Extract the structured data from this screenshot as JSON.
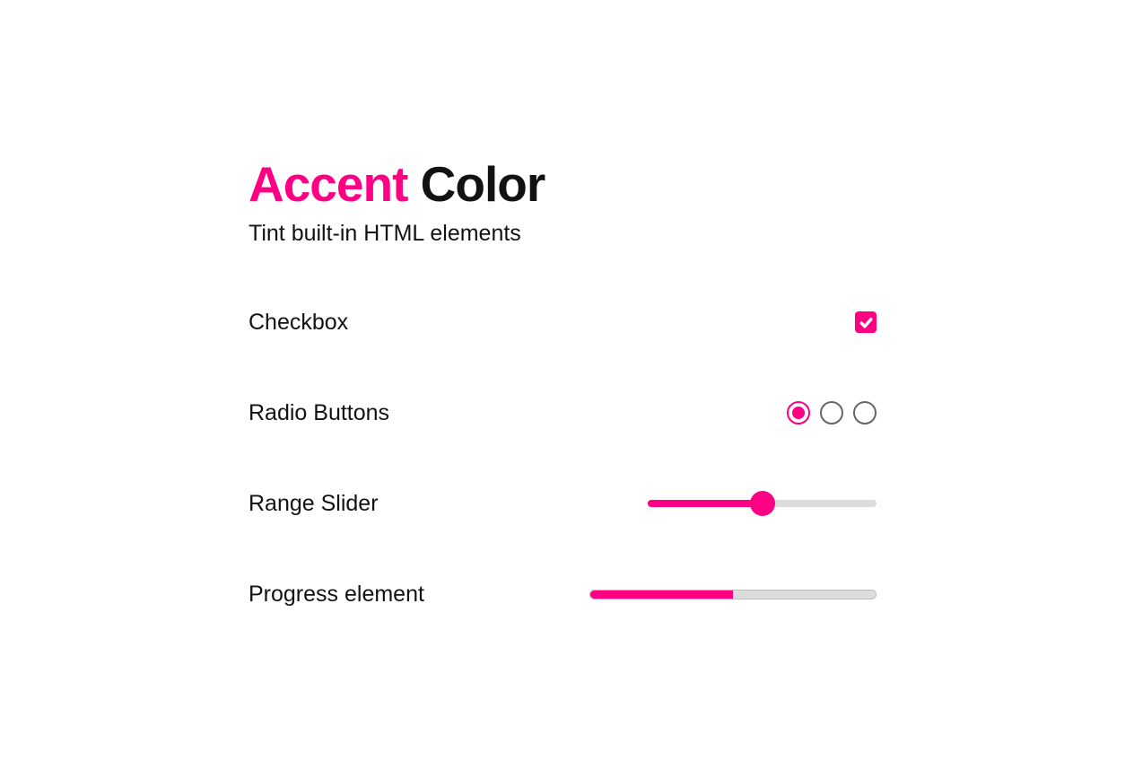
{
  "accent_color": "#ff0084",
  "title": {
    "accent_word": "Accent",
    "rest": " Color"
  },
  "subtitle": "Tint built-in HTML elements",
  "rows": {
    "checkbox": {
      "label": "Checkbox",
      "checked": true
    },
    "radio": {
      "label": "Radio Buttons",
      "options": 3,
      "selected_index": 0
    },
    "range": {
      "label": "Range Slider",
      "value": 50,
      "min": 0,
      "max": 100
    },
    "progress": {
      "label": "Progress element",
      "value": 50,
      "max": 100
    }
  }
}
